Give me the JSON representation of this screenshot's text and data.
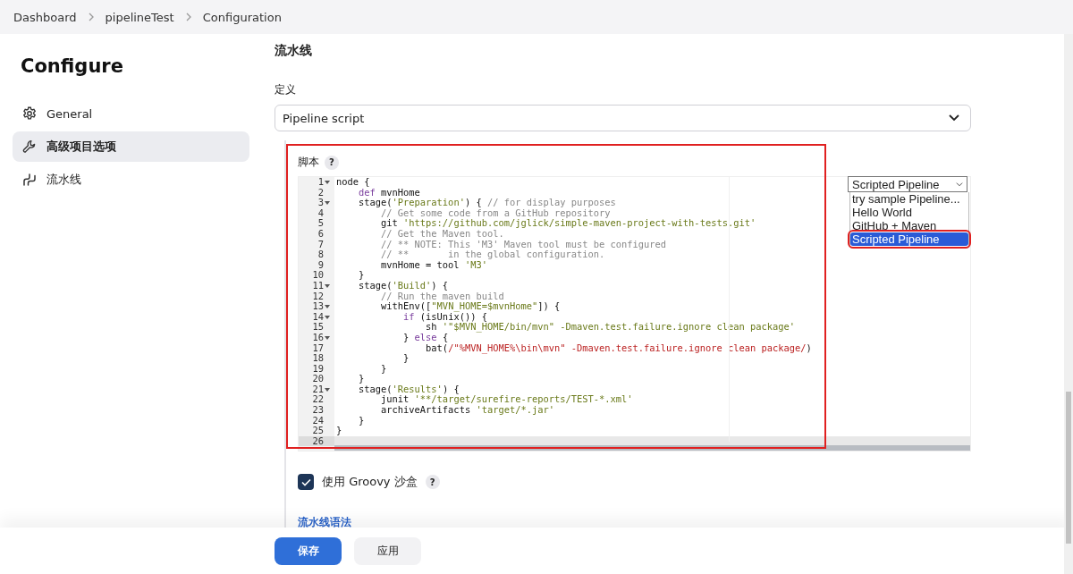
{
  "breadcrumbs": [
    {
      "label": "Dashboard"
    },
    {
      "label": "pipelineTest"
    },
    {
      "label": "Configuration"
    }
  ],
  "sidebar": {
    "title": "Configure",
    "items": [
      {
        "label": "General",
        "selected": false
      },
      {
        "label": "高级项目选项",
        "selected": true
      },
      {
        "label": "流水线",
        "selected": false
      }
    ]
  },
  "section": {
    "title": "流水线",
    "definition_label": "定义",
    "definition_value": "Pipeline script"
  },
  "script": {
    "label": "脚本",
    "help": "?",
    "lines": [
      {
        "number": "1",
        "fold": true,
        "active": false,
        "segments": [
          {
            "kind": "plain",
            "text": "node {"
          }
        ]
      },
      {
        "number": "2",
        "fold": false,
        "active": false,
        "segments": [
          {
            "kind": "keyword",
            "text": "    def"
          },
          {
            "kind": "plain",
            "text": " mvnHome"
          }
        ]
      },
      {
        "number": "3",
        "fold": true,
        "active": false,
        "segments": [
          {
            "kind": "plain",
            "text": "    stage("
          },
          {
            "kind": "string",
            "text": "'Preparation'"
          },
          {
            "kind": "plain",
            "text": ") { "
          },
          {
            "kind": "comment",
            "text": "// for display purposes"
          }
        ]
      },
      {
        "number": "4",
        "fold": false,
        "active": false,
        "segments": [
          {
            "kind": "comment",
            "text": "        // Get some code from a GitHub repository"
          }
        ]
      },
      {
        "number": "5",
        "fold": false,
        "active": false,
        "segments": [
          {
            "kind": "plain",
            "text": "        git "
          },
          {
            "kind": "string",
            "text": "'https://github.com/jglick/simple-maven-project-with-tests.git'"
          }
        ]
      },
      {
        "number": "6",
        "fold": false,
        "active": false,
        "segments": [
          {
            "kind": "comment",
            "text": "        // Get the Maven tool."
          }
        ]
      },
      {
        "number": "7",
        "fold": false,
        "active": false,
        "segments": [
          {
            "kind": "comment",
            "text": "        // ** NOTE: This 'M3' Maven tool must be configured"
          }
        ]
      },
      {
        "number": "8",
        "fold": false,
        "active": false,
        "segments": [
          {
            "kind": "comment",
            "text": "        // **       in the global configuration."
          }
        ]
      },
      {
        "number": "9",
        "fold": false,
        "active": false,
        "segments": [
          {
            "kind": "plain",
            "text": "        mvnHome = tool "
          },
          {
            "kind": "string",
            "text": "'M3'"
          }
        ]
      },
      {
        "number": "10",
        "fold": false,
        "active": false,
        "segments": [
          {
            "kind": "plain",
            "text": "    }"
          }
        ]
      },
      {
        "number": "11",
        "fold": true,
        "active": false,
        "segments": [
          {
            "kind": "plain",
            "text": "    stage("
          },
          {
            "kind": "string",
            "text": "'Build'"
          },
          {
            "kind": "plain",
            "text": ") {"
          }
        ]
      },
      {
        "number": "12",
        "fold": false,
        "active": false,
        "segments": [
          {
            "kind": "comment",
            "text": "        // Run the maven build"
          }
        ]
      },
      {
        "number": "13",
        "fold": true,
        "active": false,
        "segments": [
          {
            "kind": "plain",
            "text": "        withEnv(["
          },
          {
            "kind": "string",
            "text": "\"MVN_HOME=$mvnHome\""
          },
          {
            "kind": "plain",
            "text": "]) {"
          }
        ]
      },
      {
        "number": "14",
        "fold": true,
        "active": false,
        "segments": [
          {
            "kind": "keyword",
            "text": "            if"
          },
          {
            "kind": "plain",
            "text": " (isUnix()) {"
          }
        ]
      },
      {
        "number": "15",
        "fold": false,
        "active": false,
        "segments": [
          {
            "kind": "plain",
            "text": "                sh "
          },
          {
            "kind": "string",
            "text": "'\"$MVN_HOME/bin/mvn\" -Dmaven.test.failure.ignore clean package'"
          }
        ]
      },
      {
        "number": "16",
        "fold": true,
        "active": false,
        "segments": [
          {
            "kind": "plain",
            "text": "            } "
          },
          {
            "kind": "keyword",
            "text": "else"
          },
          {
            "kind": "plain",
            "text": " {"
          }
        ]
      },
      {
        "number": "17",
        "fold": false,
        "active": false,
        "segments": [
          {
            "kind": "plain",
            "text": "                bat("
          },
          {
            "kind": "regex",
            "text": "/\"%MVN_HOME%\\bin\\mvn\" -Dmaven.test.failure.ignore clean package/"
          },
          {
            "kind": "plain",
            "text": ")"
          }
        ]
      },
      {
        "number": "18",
        "fold": false,
        "active": false,
        "segments": [
          {
            "kind": "plain",
            "text": "            }"
          }
        ]
      },
      {
        "number": "19",
        "fold": false,
        "active": false,
        "segments": [
          {
            "kind": "plain",
            "text": "        }"
          }
        ]
      },
      {
        "number": "20",
        "fold": false,
        "active": false,
        "segments": [
          {
            "kind": "plain",
            "text": "    }"
          }
        ]
      },
      {
        "number": "21",
        "fold": true,
        "active": false,
        "segments": [
          {
            "kind": "plain",
            "text": "    stage("
          },
          {
            "kind": "string",
            "text": "'Results'"
          },
          {
            "kind": "plain",
            "text": ") {"
          }
        ]
      },
      {
        "number": "22",
        "fold": false,
        "active": false,
        "segments": [
          {
            "kind": "plain",
            "text": "        junit "
          },
          {
            "kind": "string",
            "text": "'**/target/surefire-reports/TEST-*.xml'"
          }
        ]
      },
      {
        "number": "23",
        "fold": false,
        "active": false,
        "segments": [
          {
            "kind": "plain",
            "text": "        archiveArtifacts "
          },
          {
            "kind": "string",
            "text": "'target/*.jar'"
          }
        ]
      },
      {
        "number": "24",
        "fold": false,
        "active": false,
        "segments": [
          {
            "kind": "plain",
            "text": "    }"
          }
        ]
      },
      {
        "number": "25",
        "fold": false,
        "active": false,
        "segments": [
          {
            "kind": "plain",
            "text": "}"
          }
        ]
      },
      {
        "number": "26",
        "fold": false,
        "active": true
      }
    ],
    "sample_select": {
      "value": "Scripted Pipeline",
      "options": [
        {
          "label": "try sample Pipeline...",
          "selected": false
        },
        {
          "label": "Hello World",
          "selected": false
        },
        {
          "label": "GitHub + Maven",
          "selected": false
        },
        {
          "label": "Scripted Pipeline",
          "selected": true
        }
      ]
    }
  },
  "sandbox": {
    "label": "使用 Groovy 沙盒",
    "checked": true,
    "help": "?"
  },
  "syntax_link": "流水线语法",
  "buttons": [
    {
      "label": "保存",
      "kind": "primary"
    },
    {
      "label": "应用",
      "kind": "secondary"
    }
  ]
}
